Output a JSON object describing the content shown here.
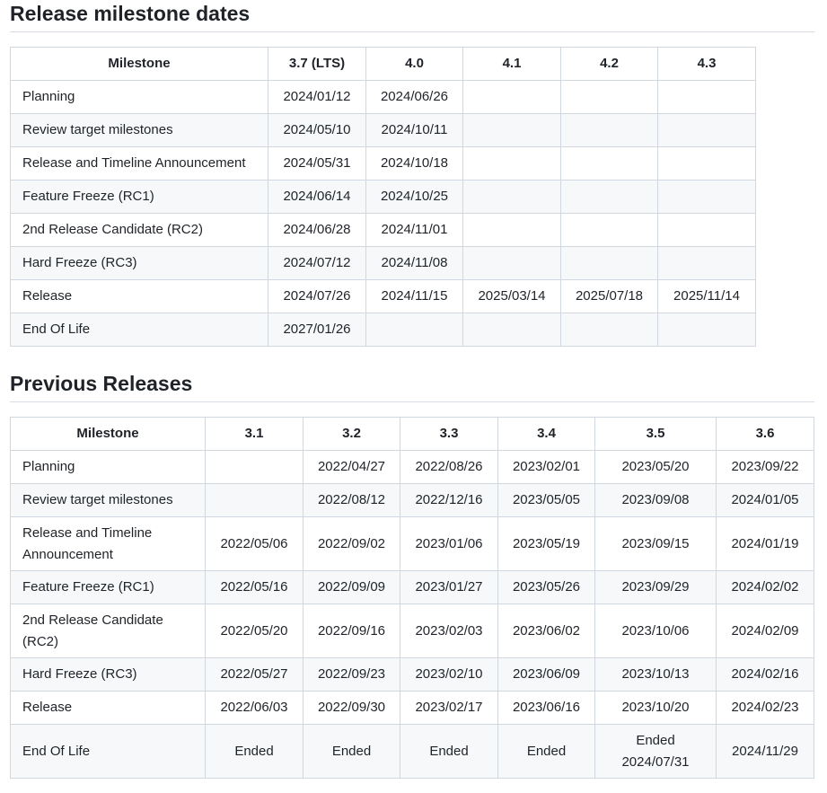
{
  "current": {
    "heading": "Release milestone dates",
    "columns": [
      "Milestone",
      "3.7 (LTS)",
      "4.0",
      "4.1",
      "4.2",
      "4.3"
    ],
    "rows": [
      [
        "Planning",
        "2024/01/12",
        "2024/06/26",
        "",
        "",
        ""
      ],
      [
        "Review target milestones",
        "2024/05/10",
        "2024/10/11",
        "",
        "",
        ""
      ],
      [
        "Release and Timeline Announcement",
        "2024/05/31",
        "2024/10/18",
        "",
        "",
        ""
      ],
      [
        "Feature Freeze (RC1)",
        "2024/06/14",
        "2024/10/25",
        "",
        "",
        ""
      ],
      [
        "2nd Release Candidate (RC2)",
        "2024/06/28",
        "2024/11/01",
        "",
        "",
        ""
      ],
      [
        "Hard Freeze (RC3)",
        "2024/07/12",
        "2024/11/08",
        "",
        "",
        ""
      ],
      [
        "Release",
        "2024/07/26",
        "2024/11/15",
        "2025/03/14",
        "2025/07/18",
        "2025/11/14"
      ],
      [
        "End Of Life",
        "2027/01/26",
        "",
        "",
        "",
        ""
      ]
    ]
  },
  "previous": {
    "heading": "Previous Releases",
    "columns": [
      "Milestone",
      "3.1",
      "3.2",
      "3.3",
      "3.4",
      "3.5",
      "3.6"
    ],
    "rows": [
      [
        "Planning",
        "",
        "2022/04/27",
        "2022/08/26",
        "2023/02/01",
        "2023/05/20",
        "2023/09/22"
      ],
      [
        "Review target milestones",
        "",
        "2022/08/12",
        "2022/12/16",
        "2023/05/05",
        "2023/09/08",
        "2024/01/05"
      ],
      [
        "Release and Timeline Announcement",
        "2022/05/06",
        "2022/09/02",
        "2023/01/06",
        "2023/05/19",
        "2023/09/15",
        "2024/01/19"
      ],
      [
        "Feature Freeze (RC1)",
        "2022/05/16",
        "2022/09/09",
        "2023/01/27",
        "2023/05/26",
        "2023/09/29",
        "2024/02/02"
      ],
      [
        "2nd Release Candidate (RC2)",
        "2022/05/20",
        "2022/09/16",
        "2023/02/03",
        "2023/06/02",
        "2023/10/06",
        "2024/02/09"
      ],
      [
        "Hard Freeze (RC3)",
        "2022/05/27",
        "2022/09/23",
        "2023/02/10",
        "2023/06/09",
        "2023/10/13",
        "2024/02/16"
      ],
      [
        "Release",
        "2022/06/03",
        "2022/09/30",
        "2023/02/17",
        "2023/06/16",
        "2023/10/20",
        "2024/02/23"
      ],
      [
        "End Of Life",
        "Ended",
        "Ended",
        "Ended",
        "Ended",
        "Ended 2024/07/31",
        "2024/11/29"
      ]
    ]
  }
}
